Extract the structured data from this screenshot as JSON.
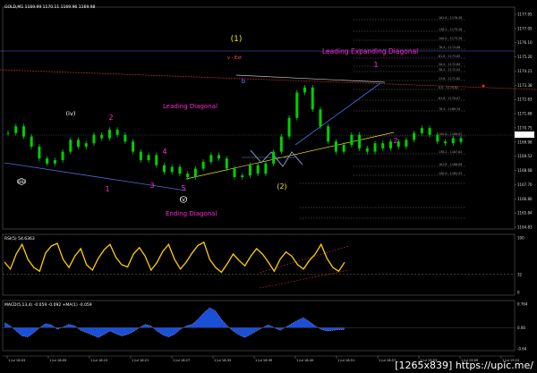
{
  "chart_window": {
    "symbol_header": "GOLD,M1  1169.99 1170.11 1169.96 1169.98",
    "rsi_header": "RSI(5) 54.6363",
    "macd_header": "MACD(5,13,4) -0.059  -0.092  +MA(1) -0.059"
  },
  "colors": {
    "background": "#000000",
    "candle": "#00d000",
    "rsi_line": "#ffd000",
    "macd_hist": "#1a4fd8",
    "wave_magenta": "#ff2bd6",
    "wave_white": "#ffffff",
    "wave_yellow": "#e8e020",
    "channel_blue": "#4a6fe0",
    "fib_grey": "#888888",
    "trend_red": "#c03030"
  },
  "annotations": [
    {
      "text": "Leading Expanding Diagonal",
      "color": "magenta"
    },
    {
      "text": "Leading Diagonal",
      "color": "magenta"
    },
    {
      "text": "Ending Diagonal",
      "color": "magenta"
    },
    {
      "text": "(1)",
      "color": "yellow"
    },
    {
      "text": "(2)",
      "color": "yellow"
    },
    {
      "text": "(iv)",
      "color": "white"
    },
    {
      "text": "(iii)",
      "color": "white"
    },
    {
      "text": "(v)",
      "color": "white"
    },
    {
      "text": "1",
      "color": "magenta"
    },
    {
      "text": "2",
      "color": "magenta"
    },
    {
      "text": "3",
      "color": "magenta"
    },
    {
      "text": "4",
      "color": "magenta"
    },
    {
      "text": "5",
      "color": "magenta"
    },
    {
      "text": "1",
      "color": "magenta"
    },
    {
      "text": "2",
      "color": "magenta"
    },
    {
      "text": "b",
      "color": "blue"
    },
    {
      "text": "v - Ext",
      "color": "red"
    }
  ],
  "fib_levels": [
    "161.8 - 1176.38",
    "138.2 - 1175.28",
    "100.0 - 1175.26",
    "76.4 - 1174.06",
    "61.8 - 1173.85",
    "50.0 - 1172.84",
    "38.2 - 1172.04",
    "23.6 - 1171.82",
    "0.0 - 1170.82",
    "61.8 - 1170.07",
    "76.4 - 1169.34",
    "100.0 - 1168.82",
    "138.2 - 1167.62",
    "161.8 - 1166.06",
    "200.0 - 1165.53"
  ],
  "price_axis": [
    "1177.95",
    "1177.05",
    "1176.10",
    "1175.20",
    "1174.21",
    "1173.38",
    "1172.63",
    "1171.68",
    "1170.75",
    "1169.98",
    "1169.53",
    "1168.68",
    "1167.70",
    "1166.80",
    "1165.84",
    "1164.83"
  ],
  "rsi_axis": [
    "100",
    "32",
    "0"
  ],
  "macd_axis": [
    "0.764",
    "0.00",
    "-0.64"
  ],
  "time_axis": [
    "1 Jul 18:03",
    "1 Jul 18:09",
    "1 Jul 18:15",
    "1 Jul 18:21",
    "1 Jul 18:27",
    "1 Jul 18:33",
    "1 Jul 18:39",
    "1 Jul 18:45",
    "1 Jul 18:51",
    "1 Jul 18:57",
    "1 Jul 19:03",
    "1 Jul 19:09",
    "1 Jul 19:15"
  ],
  "watermark": "[1265x839] https://upic.me/",
  "chart_data": [
    {
      "type": "line",
      "title": "GOLD,M1  1169.99 1170.11 1169.96 1169.98",
      "ylim": [
        1164.83,
        1177.95
      ],
      "series": [
        {
          "name": "",
          "values": [
            1170.5,
            1170.9,
            1170.3,
            1169.7,
            1169.0,
            1168.7,
            1168.9,
            1169.4,
            1170.1,
            1169.7,
            1169.9,
            1170.4,
            1170.2,
            1170.7,
            1170.4,
            1170.0,
            1169.4,
            1168.9,
            1169.2,
            1168.6,
            1168.2,
            1168.5,
            1168.1,
            1167.9,
            1168.4,
            1168.8,
            1169.2,
            1169.0,
            1168.4,
            1167.9,
            1168.0,
            1168.6,
            1168.1,
            1168.7,
            1169.4,
            1170.3,
            1171.4,
            1172.9,
            1173.2,
            1171.9,
            1170.9,
            1170.0,
            1169.4,
            1169.8,
            1170.4,
            1169.6,
            1169.4,
            1169.9,
            1169.6,
            1170.0,
            1169.7,
            1170.1,
            1170.5,
            1170.8,
            1170.4,
            1170.0,
            1169.9,
            1170.2,
            1169.98
          ]
        }
      ]
    },
    {
      "type": "line",
      "title": "RSI(5) 54.6363",
      "ylim": [
        0,
        100
      ],
      "series": [
        {
          "name": "",
          "values": [
            55,
            42,
            70,
            88,
            60,
            45,
            38,
            72,
            85,
            90,
            60,
            45,
            66,
            80,
            50,
            40,
            62,
            78,
            88,
            64,
            50,
            46,
            70,
            82,
            66,
            40,
            54,
            75,
            88,
            60,
            42,
            55,
            72,
            86,
            92,
            60,
            45,
            36,
            52,
            70,
            58,
            48,
            66,
            80,
            70,
            55,
            38,
            60,
            74,
            66,
            50,
            42,
            58,
            70,
            88,
            62,
            45,
            38,
            54.6
          ]
        }
      ]
    },
    {
      "type": "bar",
      "title": "MACD(5,13,4) -0.059  -0.092  +MA(1) -0.059",
      "ylim": [
        -0.64,
        0.764
      ],
      "series": [
        {
          "name": "",
          "values": [
            0.15,
            0.05,
            -0.1,
            -0.25,
            -0.28,
            -0.15,
            0.0,
            0.12,
            0.08,
            -0.05,
            0.02,
            0.1,
            0.05,
            -0.08,
            -0.15,
            -0.22,
            -0.3,
            -0.2,
            -0.1,
            -0.18,
            -0.25,
            -0.2,
            -0.12,
            0.0,
            0.1,
            0.05,
            -0.1,
            -0.22,
            -0.28,
            -0.2,
            -0.05,
            0.05,
            0.1,
            0.25,
            0.45,
            0.6,
            0.5,
            0.25,
            0.05,
            -0.1,
            -0.22,
            -0.3,
            -0.2,
            -0.1,
            0.0,
            0.08,
            0.0,
            -0.08,
            0.02,
            0.12,
            0.22,
            0.3,
            0.18,
            0.05,
            -0.05,
            -0.1,
            -0.08,
            -0.06,
            -0.059
          ]
        }
      ]
    }
  ]
}
